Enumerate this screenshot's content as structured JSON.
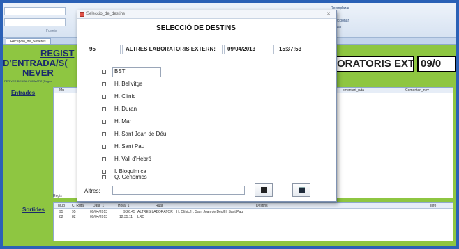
{
  "ribbon": {
    "combo_label": "Fuente",
    "buttons": [
      "Reemplazar",
      "Ir a",
      "Seleccionar",
      "Buscar"
    ]
  },
  "doc_tab": {
    "label": "Recepcio_de_Neveres"
  },
  "background_form": {
    "title_lines": [
      "REGIST",
      "D'ENTRADA/S(",
      "NEVER"
    ],
    "small_text": "PER VER DES/SA PORMAT 2 (Regra",
    "lab_box": "ORATORIS EXTE",
    "date_box": "09/0",
    "entrades_label": "Entrades",
    "entrades_headers": [
      "Mu",
      "omentari_ruta",
      "Comentari_nev"
    ],
    "sortides_label": "Sortides",
    "sortides_headers": [
      "Mug",
      "C_Ruta",
      "Data_1",
      "Hora_1",
      "Ruta",
      "Destins",
      "Info"
    ],
    "sortides_rows": [
      {
        "mug": "95",
        "c_ruta": "95",
        "data": "09/04/2013",
        "hora": "9:26:45",
        "ruta": "ALTRES LABORATOR",
        "destins": "H. Clínic/H. Sant Joan de Déu/H. Sant Pau"
      },
      {
        "mug": "82",
        "c_ruta": "82",
        "data": "09/04/2013",
        "hora": "12:35:11",
        "ruta": "LRC",
        "destins": ""
      }
    ],
    "record_label": "Regis"
  },
  "dialog": {
    "title": "Seleccio_de_destins",
    "heading": "SELECCIÓ DE DESTINS",
    "number": "95",
    "lab": "ALTRES LABORATORIS EXTERN:",
    "date": "09/04/2013",
    "time": "15:37:53",
    "destinations": [
      "BST",
      "H. Bellvitge",
      "H. Clínic",
      "H. Duran",
      "H. Mar",
      "H. Sant Joan de Déu",
      "H. Sant Pau",
      "H. Vall d'Hebró",
      "I. Bioquimica",
      "Q. Genomics"
    ],
    "altres_label": "Altres:",
    "altres_value": ""
  }
}
